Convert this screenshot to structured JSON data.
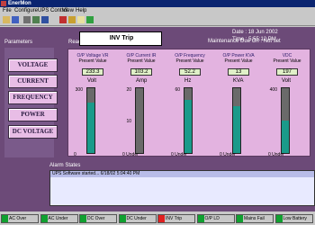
{
  "window": {
    "title": "EnerMon"
  },
  "menu": [
    "File",
    "Configure",
    "UPS Control",
    "View",
    "Help"
  ],
  "toolbar_icons": [
    "open-icon",
    "save-icon",
    "print-icon",
    "search-icon",
    "help-icon",
    "control-icon",
    "settings-icon",
    "notes-icon",
    "check-icon"
  ],
  "header": {
    "date_label": "Date : 18 Jun 2002",
    "time_label": "Time : 5:55:12 PM",
    "maintenance_label": "Maintenance Due On : Not set",
    "parameters_title": "Parameters",
    "readings_title": "Read"
  },
  "parameters": [
    "VOLTAGE",
    "CURRENT",
    "FREQUENCY",
    "POWER",
    "DC VOLTAGE"
  ],
  "meters": [
    {
      "title": "O/P Voltage VR",
      "present_value": "233.3",
      "unit": "Volt",
      "max": "300",
      "mid": "",
      "min": "0",
      "level": 0.78
    },
    {
      "title": "O/P Current IR",
      "present_value": "103.2",
      "unit": "Amp",
      "max": "20",
      "mid": "10",
      "min": "0 Under",
      "level": 0.0
    },
    {
      "title": "O/P Frequency",
      "present_value": "52.2",
      "unit": "Hz",
      "max": "60",
      "mid": "",
      "min": "0 Under",
      "level": 0.82
    },
    {
      "title": "O/P Power KVA",
      "present_value": "13",
      "unit": "KVA",
      "max": "",
      "mid": "",
      "min": "0 Under",
      "level": 0.72
    },
    {
      "title": "VDC",
      "present_value": "197",
      "unit": "Volt",
      "max": "400",
      "mid": "",
      "min": "0 Under",
      "level": 0.5
    }
  ],
  "present_value_label": "Present Value",
  "popup": {
    "text": "INV Trip"
  },
  "alarm": {
    "title": "Alarm States",
    "entries": [
      "UPS Software started...   6/18/02 5:04:40 PM"
    ]
  },
  "status_indicators": [
    {
      "label": "AC Over",
      "color": "#10a030"
    },
    {
      "label": "AC Under",
      "color": "#10a030"
    },
    {
      "label": "DC Over",
      "color": "#10a030"
    },
    {
      "label": "DC Under",
      "color": "#10a030"
    },
    {
      "label": "INV Trip",
      "color": "#e02020"
    },
    {
      "label": "O/P LD",
      "color": "#10a030"
    },
    {
      "label": "Mains Fail",
      "color": "#10a030"
    },
    {
      "label": "Low Battery",
      "color": "#10a030"
    }
  ]
}
